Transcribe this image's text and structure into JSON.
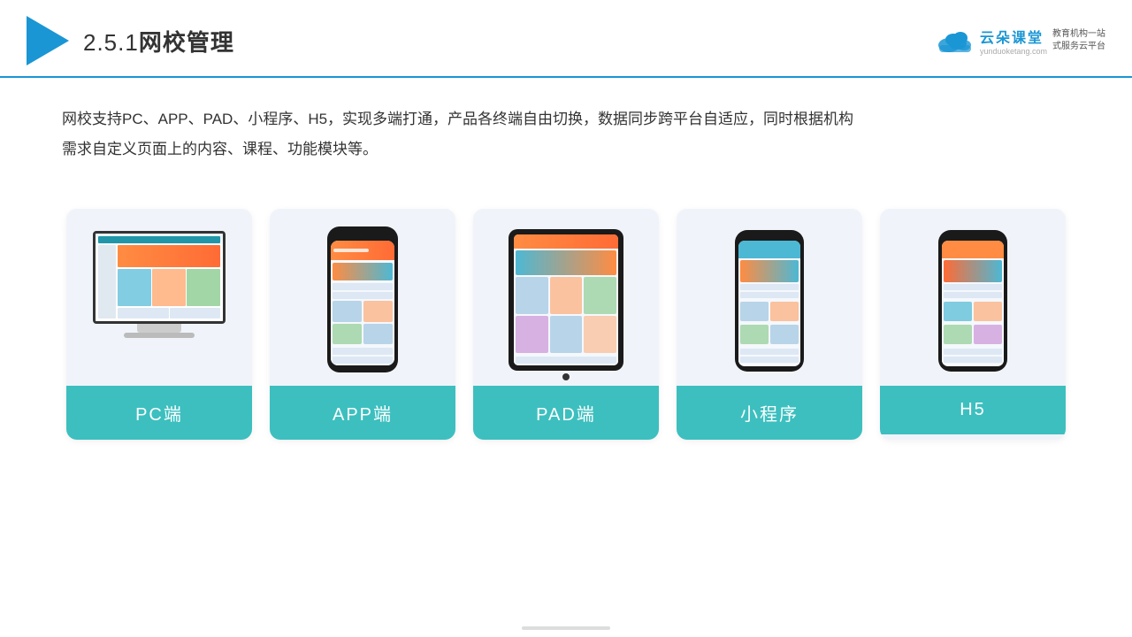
{
  "header": {
    "title": "2.5.1网校管理",
    "title_num": "2.5.1",
    "title_text": "网校管理"
  },
  "logo": {
    "brand": "云朵课堂",
    "url": "yunduoketang.com",
    "tagline": "教育机构一站\n式服务云平台"
  },
  "description": {
    "text": "网校支持PC、APP、PAD、小程序、H5，实现多端打通，产品各终端自由切换，数据同步跨平台自适应，同时根据机构需求自定义页面上的内容、课程、功能模块等。"
  },
  "cards": [
    {
      "id": "pc",
      "label": "PC端"
    },
    {
      "id": "app",
      "label": "APP端"
    },
    {
      "id": "pad",
      "label": "PAD端"
    },
    {
      "id": "mini",
      "label": "小程序"
    },
    {
      "id": "h5",
      "label": "H5"
    }
  ]
}
